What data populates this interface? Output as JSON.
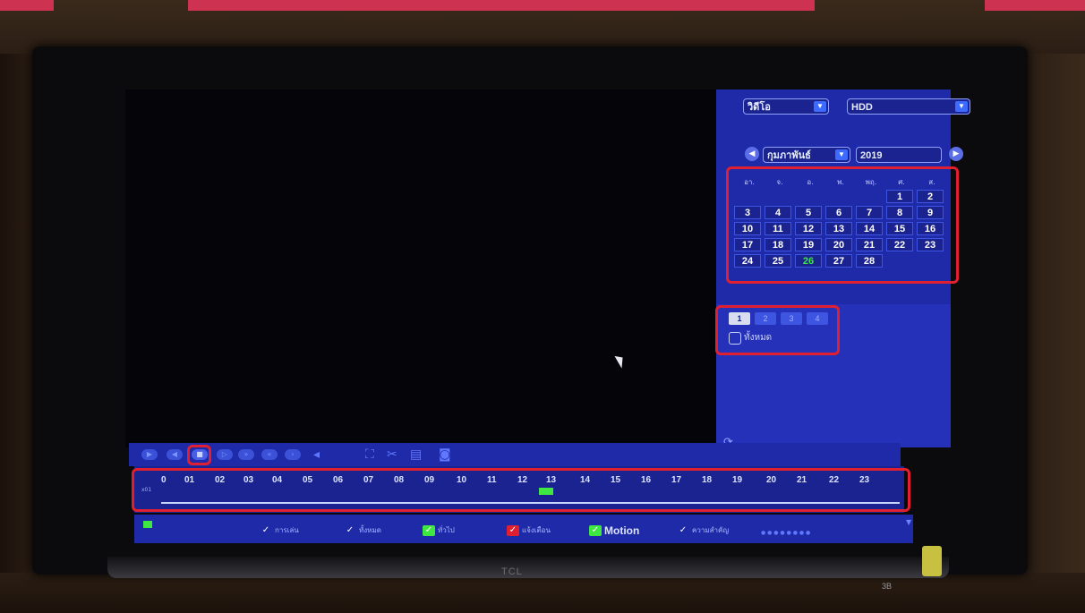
{
  "source": {
    "value": "วิดีโอ",
    "arrow": "▼"
  },
  "disk": {
    "value": "HDD",
    "arrow": "▼"
  },
  "month_nav": {
    "prev": "◀",
    "next": "▶"
  },
  "month": {
    "value": "กุมภาพันธ์",
    "arrow": "▼"
  },
  "year": {
    "value": "2019"
  },
  "calendar": {
    "weekdays": [
      "อา.",
      "จ.",
      "อ.",
      "พ.",
      "พฤ.",
      "ศ.",
      "ส."
    ],
    "weeks": [
      [
        "",
        "",
        "",
        "",
        "",
        "1",
        "2"
      ],
      [
        "3",
        "4",
        "5",
        "6",
        "7",
        "8",
        "9"
      ],
      [
        "10",
        "11",
        "12",
        "13",
        "14",
        "15",
        "16"
      ],
      [
        "17",
        "18",
        "19",
        "20",
        "21",
        "22",
        "23"
      ],
      [
        "24",
        "25",
        "26",
        "27",
        "28",
        "",
        ""
      ]
    ],
    "recorded_days": [
      "26"
    ]
  },
  "channels": [
    "1",
    "2",
    "3",
    "4"
  ],
  "all_channels_label": "ทั้งหมด",
  "timeline": {
    "hours": [
      "0",
      "01",
      "02",
      "03",
      "04",
      "05",
      "06",
      "07",
      "08",
      "09",
      "10",
      "11",
      "12",
      "13",
      "14",
      "15",
      "16",
      "17",
      "18",
      "19",
      "20",
      "21",
      "22",
      "23"
    ],
    "scale": "x01"
  },
  "filters": [
    {
      "label": "การเล่น",
      "color": "#1f2aa8"
    },
    {
      "label": "ทั้งหมด",
      "color": "#1f2aa8"
    },
    {
      "label": "ทั่วไป",
      "color": "#3ee840"
    },
    {
      "label": "แจ้งเตือน",
      "color": "#e02030"
    },
    {
      "label": "Motion",
      "color": "#3ee840"
    },
    {
      "label": "ความสำคัญ",
      "color": "#1f2aa8"
    }
  ],
  "check_mark": "✓",
  "tv": {
    "brand": "TCL",
    "badge": "3B"
  },
  "icons": {
    "refresh": "⟳",
    "fullscreen": "⛶",
    "clip": "✂",
    "save": "▤",
    "snapshot": "◙",
    "audio": "◂",
    "down_arrow": "▼"
  },
  "colors": {
    "panel": "#1f2aa8",
    "highlight": "#e02030",
    "record": "#3ee840"
  }
}
